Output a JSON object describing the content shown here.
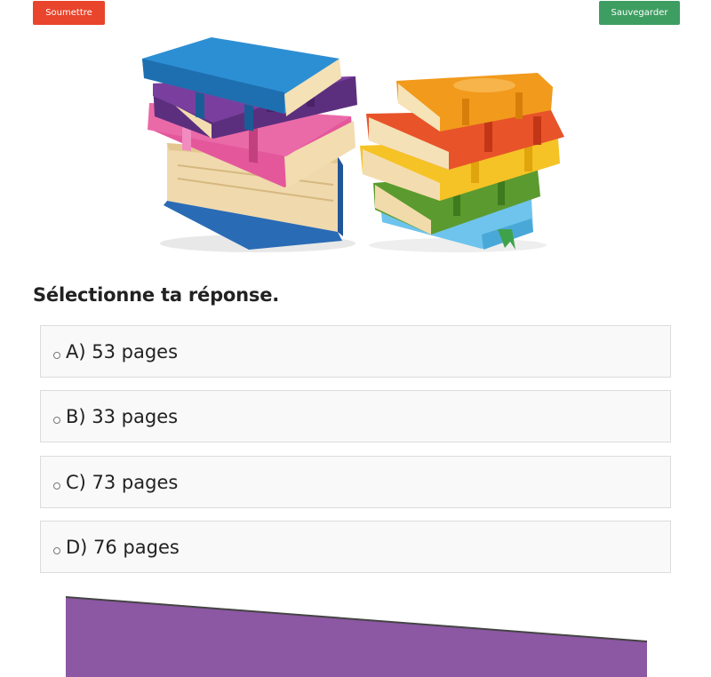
{
  "toolbar": {
    "submit_label": "Soumettre",
    "save_label": "Sauvegarder",
    "submit_color": "#e8452c",
    "save_color": "#3e9e62"
  },
  "illustration": {
    "icon": "books-stack-illustration"
  },
  "question": {
    "prompt": "Sélectionne ta réponse.",
    "options": [
      {
        "label": "A) 53 pages"
      },
      {
        "label": "B) 33 pages"
      },
      {
        "label": "C) 73 pages"
      },
      {
        "label": "D) 76 pages"
      }
    ]
  },
  "decor": {
    "bottom_panel_color": "#8c57a3"
  }
}
